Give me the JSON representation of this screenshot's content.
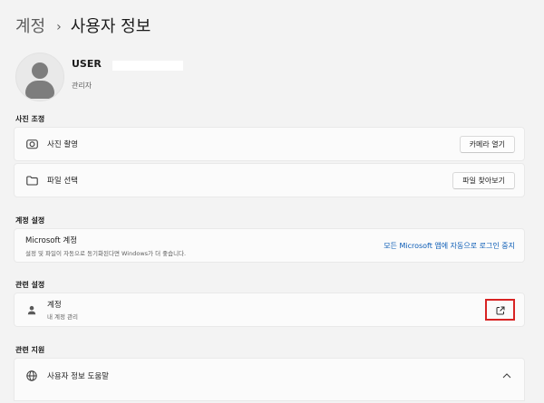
{
  "breadcrumb": {
    "parent": "계정",
    "separator": "›",
    "current": "사용자 정보"
  },
  "profile": {
    "name": "USER",
    "role": "관리자"
  },
  "sections": {
    "photo": {
      "title": "사진 조정",
      "camera": {
        "label": "사진 촬영",
        "icon": "camera-icon",
        "button": "카메라 열기"
      },
      "file": {
        "label": "파일 선택",
        "icon": "folder-icon",
        "button": "파일 찾아보기"
      }
    },
    "account_settings": {
      "title": "계정 설정",
      "microsoft": {
        "title": "Microsoft 계정",
        "description": "설정 및 파일이 자동으로 동기화된다면 Windows가 더 좋습니다.",
        "link": "모든 Microsoft 앱에 자동으로 로그인 중지"
      }
    },
    "related_settings": {
      "title": "관련 설정",
      "accounts": {
        "title": "계정",
        "description": "내 계정 관리",
        "icon": "person-icon",
        "action_icon": "open-external-icon"
      }
    },
    "related_support": {
      "title": "관련 지원",
      "help": {
        "label": "사용자 정보 도움말",
        "icon": "globe-icon",
        "expand_icon": "chevron-up-icon"
      }
    }
  },
  "colors": {
    "background": "#f3f3f3",
    "card": "#fbfbfb",
    "link": "#0a5bb5",
    "highlight_border": "#d82424"
  }
}
